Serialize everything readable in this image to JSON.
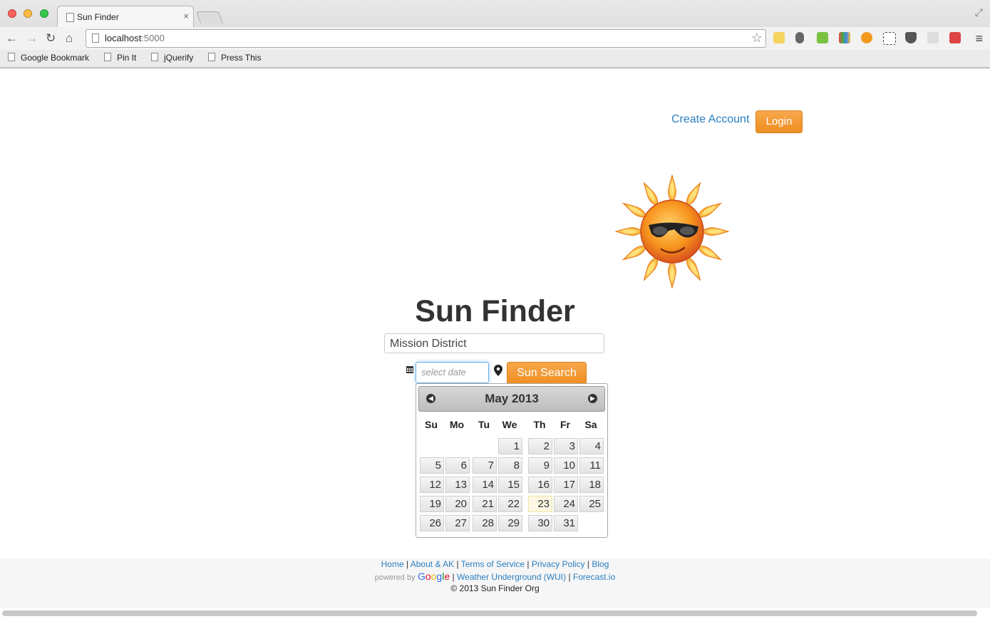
{
  "browser": {
    "tab_title": "Sun Finder",
    "url_host": "localhost",
    "url_port": ":5000",
    "bookmarks": [
      "Google Bookmark",
      "Pin It",
      "jQuerify",
      "Press This"
    ]
  },
  "page": {
    "create_account": "Create Account",
    "login": "Login",
    "title": "Sun Finder",
    "location_value": "Mission District",
    "date_placeholder": "select date",
    "search_button": "Sun Search"
  },
  "datepicker": {
    "month_title": "May 2013",
    "weekdays": [
      "Su",
      "Mo",
      "Tu",
      "We",
      "Th",
      "Fr",
      "Sa"
    ],
    "weeks": [
      [
        "",
        "",
        "",
        "1",
        "2",
        "3",
        "4"
      ],
      [
        "5",
        "6",
        "7",
        "8",
        "9",
        "10",
        "11"
      ],
      [
        "12",
        "13",
        "14",
        "15",
        "16",
        "17",
        "18"
      ],
      [
        "19",
        "20",
        "21",
        "22",
        "23",
        "24",
        "25"
      ],
      [
        "26",
        "27",
        "28",
        "29",
        "30",
        "31",
        ""
      ]
    ],
    "highlighted_day": "23"
  },
  "footer": {
    "links": [
      "Home",
      "About & AK",
      "Terms of Service",
      "Privacy Policy",
      "Blog"
    ],
    "powered_by": "powered by",
    "google": "Google",
    "data_links": [
      "Weather Underground (WUI)",
      "Forecast.io"
    ],
    "copyright": "© 2013 Sun Finder Org"
  }
}
